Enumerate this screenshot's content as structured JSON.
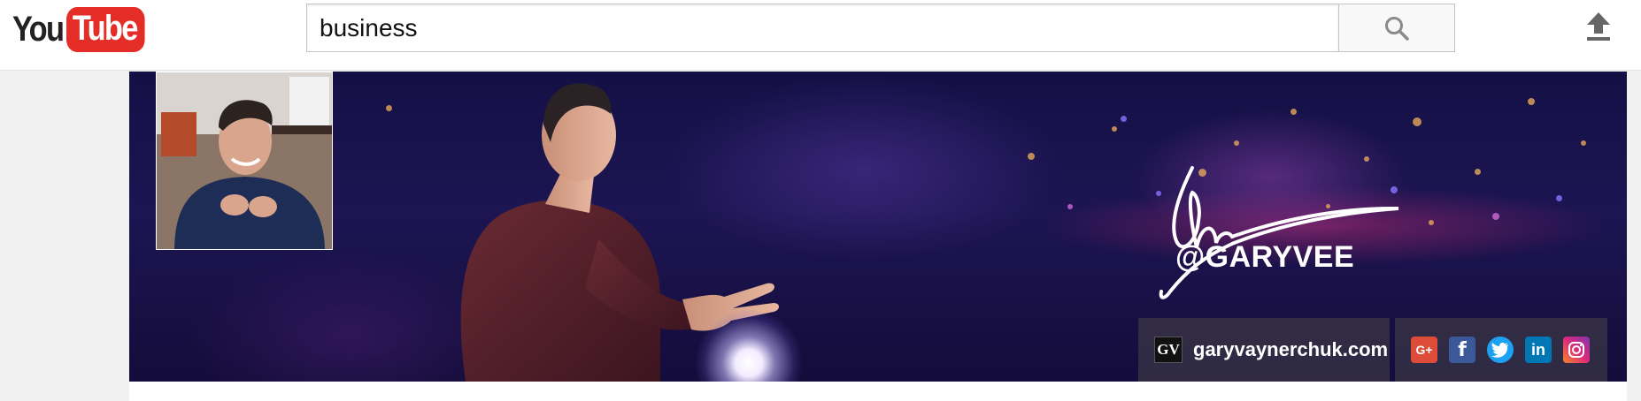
{
  "masthead": {
    "logo": {
      "you": "You",
      "tube": "Tube"
    },
    "search": {
      "query": "business",
      "button_icon": "search-icon"
    },
    "upload_icon": "upload-icon"
  },
  "channel_header": {
    "banner_handle": "@GARYVEE",
    "signature_icon": "signature-logo",
    "website": {
      "badge": "GV",
      "label": "garyvaynerchuk.com"
    },
    "social": [
      {
        "name": "google-plus-icon",
        "glyph": "G+",
        "color": "#dd4b39"
      },
      {
        "name": "facebook-icon",
        "glyph": "f",
        "color": "#3b5998"
      },
      {
        "name": "twitter-icon",
        "glyph": "🐦",
        "color": "#1da1f2"
      },
      {
        "name": "linkedin-icon",
        "glyph": "in",
        "color": "#0077b5"
      },
      {
        "name": "instagram-icon",
        "glyph": "◎",
        "color": "#c13584"
      }
    ]
  },
  "colors": {
    "youtube_red": "#e52d27",
    "banner_dark": "#1a1450"
  }
}
